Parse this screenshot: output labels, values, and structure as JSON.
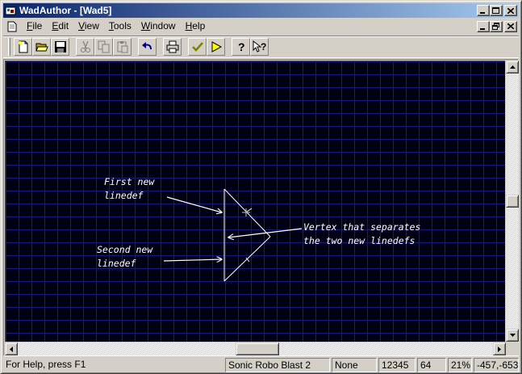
{
  "window": {
    "title": "WadAuthor - [Wad5]"
  },
  "menu": {
    "items": [
      {
        "label": "File",
        "accel": "F",
        "rest": "ile"
      },
      {
        "label": "Edit",
        "accel": "E",
        "rest": "dit"
      },
      {
        "label": "View",
        "accel": "V",
        "rest": "iew"
      },
      {
        "label": "Tools",
        "accel": "T",
        "rest": "ools"
      },
      {
        "label": "Window",
        "accel": "W",
        "rest": "indow"
      },
      {
        "label": "Help",
        "accel": "H",
        "rest": "elp"
      }
    ]
  },
  "toolbar": {
    "buttons": [
      {
        "icon": "new-document-icon",
        "enabled": true
      },
      {
        "icon": "open-folder-icon",
        "enabled": true
      },
      {
        "icon": "save-disk-icon",
        "enabled": true
      },
      {
        "icon": "cut-scissors-icon",
        "enabled": false
      },
      {
        "icon": "copy-icon",
        "enabled": false
      },
      {
        "icon": "paste-icon",
        "enabled": false
      },
      {
        "icon": "undo-arrow-icon",
        "enabled": true
      },
      {
        "icon": "print-icon",
        "enabled": true
      },
      {
        "icon": "check-icon",
        "enabled": true
      },
      {
        "icon": "run-play-icon",
        "enabled": true
      },
      {
        "icon": "help-icon",
        "enabled": true
      },
      {
        "icon": "context-help-icon",
        "enabled": true
      }
    ]
  },
  "canvas": {
    "background_color": "#000014",
    "grid_color": "#1a1a7a",
    "line_color": "#ffffff",
    "annotations": {
      "first": [
        "First new",
        "linedef"
      ],
      "second": [
        "Second new",
        "linedef"
      ],
      "vertex": [
        "Vertex that separates",
        "the two new linedefs"
      ]
    }
  },
  "statusbar": {
    "help": "For Help, press F1",
    "game": "Sonic Robo Blast 2",
    "mode": "None",
    "value1": "12345",
    "grid": "64",
    "zoom": "21%",
    "coords": "-457,-653"
  }
}
